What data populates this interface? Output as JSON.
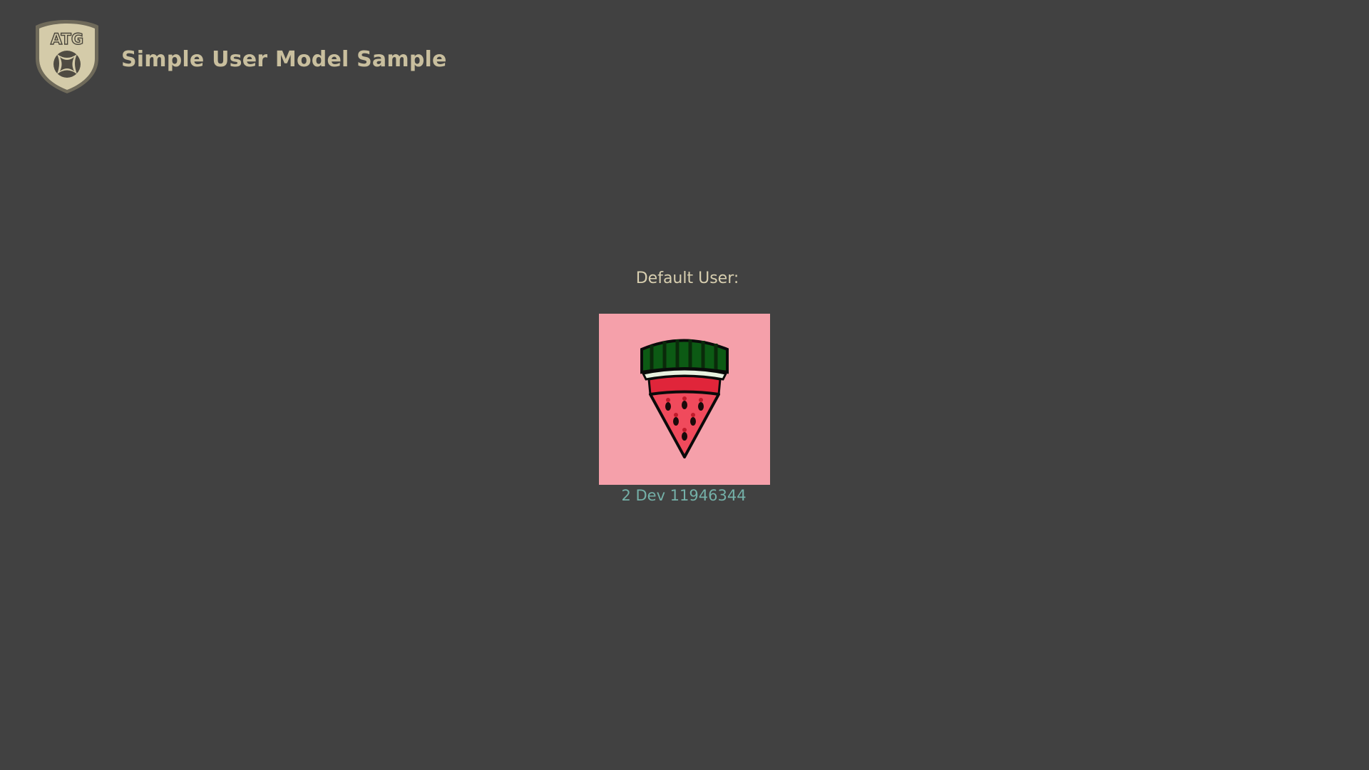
{
  "header": {
    "logo_text": "ATG",
    "title": "Simple User Model Sample"
  },
  "main": {
    "default_user_label": "Default User:",
    "user": {
      "gamertag": "2 Dev 11946344",
      "avatar_icon": "watermelon-icon",
      "avatar_background": "#f5a0aa"
    }
  },
  "colors": {
    "background": "#414141",
    "title": "#c9bf9e",
    "label": "#d8cfb0",
    "gamertag": "#74b0a8"
  }
}
